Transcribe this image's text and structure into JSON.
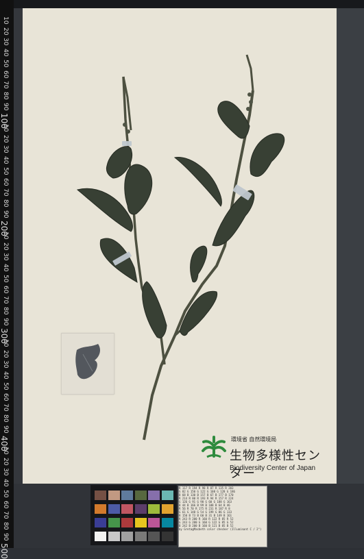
{
  "header": {
    "title": "",
    "subtitle": ""
  },
  "ruler": {
    "marks": [
      "10",
      "20",
      "30",
      "40",
      "50",
      "60",
      "70",
      "80",
      "90",
      "100",
      "10",
      "20",
      "30",
      "40",
      "50",
      "60",
      "70",
      "80",
      "90",
      "200",
      "10",
      "20",
      "30",
      "40",
      "50",
      "60",
      "70",
      "80",
      "90",
      "300",
      "10",
      "20",
      "30",
      "40",
      "50",
      "60",
      "70",
      "80",
      "90",
      "400",
      "10",
      "20",
      "30",
      "40",
      "50",
      "60",
      "70",
      "80",
      "90",
      "500"
    ]
  },
  "specimen": {
    "envelope_label": "",
    "institution_small": "環境省 自然環境局",
    "institution_main": "生物多様性センター",
    "institution_en": "Biodiversity Center of Japan"
  },
  "data_card": {
    "rows": [
      "R 117  R 194  R 98  R 87  R 135 R 203",
      "G 82   G 150  G 122 G 108 G 128 G 186",
      "B 68   B 130  B 157 B 67  B 177 B 170",
      "R 214  R 80   R 193 R 94  R 157 R 224",
      "G 126  G 91   G 90  G 60  G 188 G 163",
      "B 44   B 166  B 99  B 108 B 64  B 46",
      "R 56   R 70   R 175 R 231 R 187 R 8",
      "G 61   G 148  G 54  G 199 G 86  G 133",
      "B 150  B 73   B 60  B 31  B 149 B 161",
      "R 243  R 200  R 160 R 122 R 85  R 52",
      "G 243  G 200  G 160 G 122 G 85  G 52",
      "B 242  B 200  B 160 B 121 B 85  B 52"
    ],
    "footer": "by GretagMacbeth color checker  (Illuminant C / 2°)"
  },
  "colors": {
    "sheet": "#e8e4d7",
    "leaf": "#3c4335",
    "stem": "#4d5040",
    "logo_green": "#2e8b3d"
  }
}
